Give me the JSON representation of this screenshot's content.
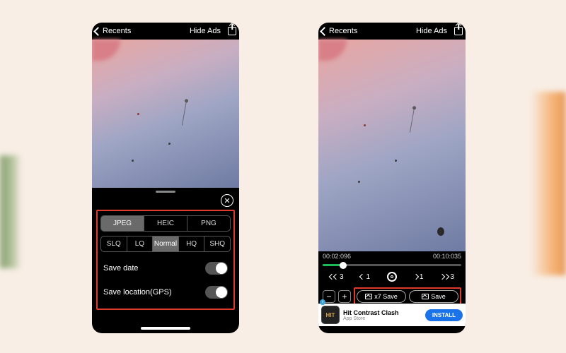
{
  "nav": {
    "back_label": "Recents",
    "hide_ads_label": "Hide Ads"
  },
  "format_seg": {
    "options": [
      "JPEG",
      "HEIC",
      "PNG"
    ],
    "selected": "JPEG"
  },
  "quality_seg": {
    "options": [
      "SLQ",
      "LQ",
      "Normal",
      "HQ",
      "SHQ"
    ],
    "selected": "Normal"
  },
  "options": {
    "save_date": {
      "label": "Save date",
      "on": false
    },
    "save_location": {
      "label": "Save location(GPS)",
      "on": false
    }
  },
  "timecodes": {
    "current": "00:02:096",
    "total": "00:10:035"
  },
  "controls": {
    "rew_label": "3",
    "back1_label": "1",
    "fwd1_label": "1",
    "fwd_label": "3"
  },
  "save_buttons": {
    "multi": "x7 Save",
    "single": "Save"
  },
  "ad": {
    "icon_text": "HIT",
    "title": "Hit Contrast Clash",
    "subtitle": "App Store",
    "cta": "INSTALL"
  }
}
